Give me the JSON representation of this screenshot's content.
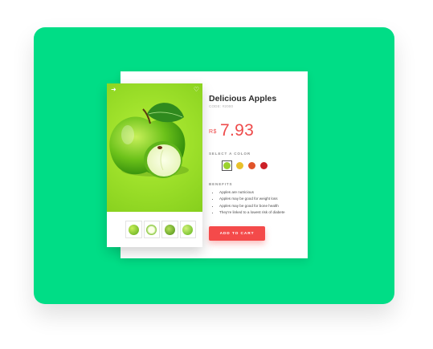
{
  "product": {
    "title": "Delicious Apples",
    "code": "CODE: #2000",
    "currency": "R$",
    "price": "7.93"
  },
  "colors": {
    "label": "SELECT A COLOR",
    "options": [
      {
        "name": "green",
        "hex": "#9bd22e",
        "selected": true
      },
      {
        "name": "yellow",
        "hex": "#e8c12a",
        "selected": false
      },
      {
        "name": "orange-red",
        "hex": "#e0542a",
        "selected": false
      },
      {
        "name": "red",
        "hex": "#cc2027",
        "selected": false
      }
    ]
  },
  "benefits": {
    "label": "BENEFITS",
    "items": [
      "Apples are nutricious",
      "Apples may be good for weight loss",
      "Apples may be good for bone health",
      "They're linked to a lowest risk of diabete"
    ]
  },
  "cart": {
    "label": "ADD TO CART"
  },
  "icons": {
    "share": "share-icon",
    "heart": "heart-icon"
  },
  "accent": {
    "green": "#00dd86",
    "red": "#f44a4a"
  }
}
